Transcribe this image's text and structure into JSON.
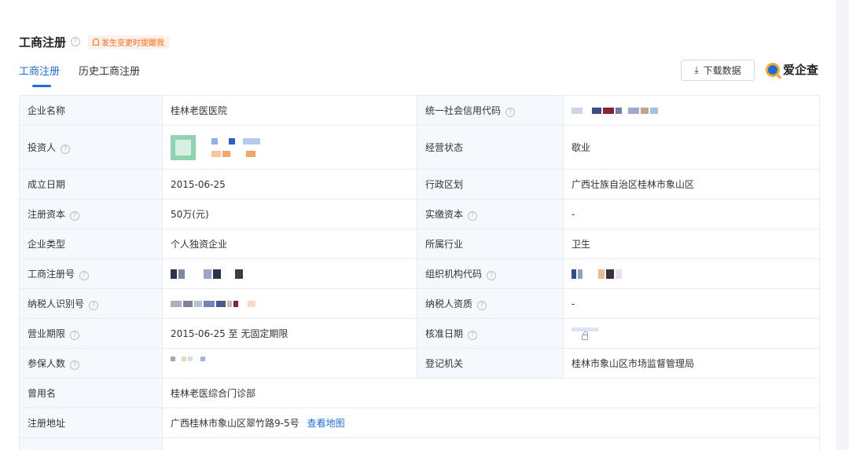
{
  "section": {
    "title": "工商注册",
    "alert_label": "发生变更时提醒我"
  },
  "tabs": [
    {
      "label": "工商注册",
      "active": true
    },
    {
      "label": "历史工商注册",
      "active": false
    }
  ],
  "toolbar": {
    "download_label": "下载数据",
    "brand_name": "爱企查"
  },
  "colors": {
    "accent": "#1a6fdf",
    "alert": "#ff6b1a",
    "label_bg": "#f5f8fc",
    "border": "#e8ecf2"
  },
  "rows": [
    {
      "label1": "企业名称",
      "value1": "桂林老医医院",
      "label2": "统一社会信用代码",
      "value2": ""
    },
    {
      "label1": "投资人",
      "value1": "",
      "label2": "经营状态",
      "value2": "歇业"
    },
    {
      "label1": "成立日期",
      "value1": "2015-06-25",
      "label2": "行政区划",
      "value2": "广西壮族自治区桂林市象山区"
    },
    {
      "label1": "注册资本",
      "value1": "50万(元)",
      "label2": "实缴资本",
      "value2": "-"
    },
    {
      "label1": "企业类型",
      "value1": "个人独资企业",
      "label2": "所属行业",
      "value2": "卫生"
    },
    {
      "label1": "工商注册号",
      "value1": "",
      "label2": "组织机构代码",
      "value2": ""
    },
    {
      "label1": "纳税人识别号",
      "value1": "",
      "label2": "纳税人资质",
      "value2": "-"
    },
    {
      "label1": "营业期限",
      "value1": "2015-06-25 至 无固定期限",
      "label2": "核准日期",
      "value2": ""
    },
    {
      "label1": "参保人数",
      "value1": "",
      "label2": "登记机关",
      "value2": "桂林市象山区市场监督管理局"
    },
    {
      "label1": "曾用名",
      "value1": "桂林老医综合门诊部"
    },
    {
      "label1": "注册地址",
      "value1": "广西桂林市象山区翠竹路9-5号",
      "link": "查看地图"
    }
  ]
}
